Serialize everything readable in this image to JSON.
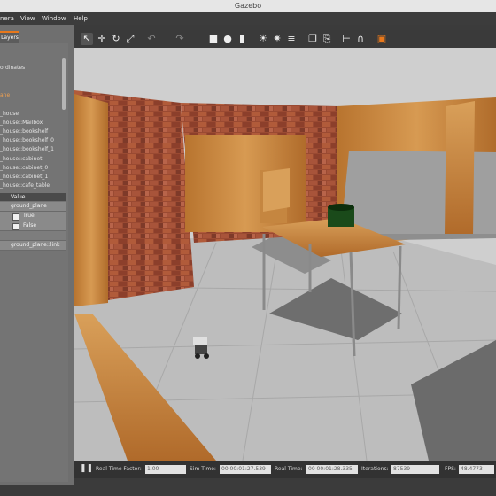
{
  "window": {
    "title": "Gazebo"
  },
  "menu": [
    "nera",
    "View",
    "Window",
    "Help"
  ],
  "left_panel": {
    "tab_label": "Layers",
    "tree": [
      {
        "label": "ordinates",
        "highlight": false
      },
      {
        "label": "ane",
        "highlight": true
      },
      {
        "label": "_house",
        "highlight": false
      },
      {
        "label": "_house::Mailbox",
        "highlight": false
      },
      {
        "label": "_house::bookshelf",
        "highlight": false
      },
      {
        "label": "_house::bookshelf_0",
        "highlight": false
      },
      {
        "label": "_house::bookshelf_1",
        "highlight": false
      },
      {
        "label": "_house::cabinet",
        "highlight": false
      },
      {
        "label": "_house::cabinet_0",
        "highlight": false
      },
      {
        "label": "_house::cabinet_1",
        "highlight": false
      },
      {
        "label": "_house::cafe_table",
        "highlight": false
      }
    ],
    "properties": {
      "header": "Value",
      "rows": [
        "ground_plane",
        "True",
        "False"
      ],
      "link_row": "ground_plane::link"
    }
  },
  "toolbar": {
    "icons": [
      "select-arrow-icon",
      "translate-icon",
      "rotate-icon",
      "scale-icon",
      "undo-icon",
      "redo-icon",
      "box-icon",
      "sphere-icon",
      "cylinder-icon",
      "point-light-icon",
      "spot-light-icon",
      "directional-light-icon",
      "copy-icon",
      "paste-icon",
      "align-icon",
      "snap-icon",
      "screenshot-icon"
    ]
  },
  "status": {
    "real_time_factor_label": "Real Time Factor:",
    "real_time_factor": "1.00",
    "sim_time_label": "Sim Time:",
    "sim_time": "00 00:01:27.539",
    "real_time_label": "Real Time:",
    "real_time": "00 00:01:28.335",
    "iterations_label": "Iterations:",
    "iterations": "87539",
    "fps_label": "FPS:",
    "fps": "48.4773"
  },
  "colors": {
    "accent": "#e8781b",
    "brick": "#9a4a32",
    "wood": "#c9863c"
  }
}
